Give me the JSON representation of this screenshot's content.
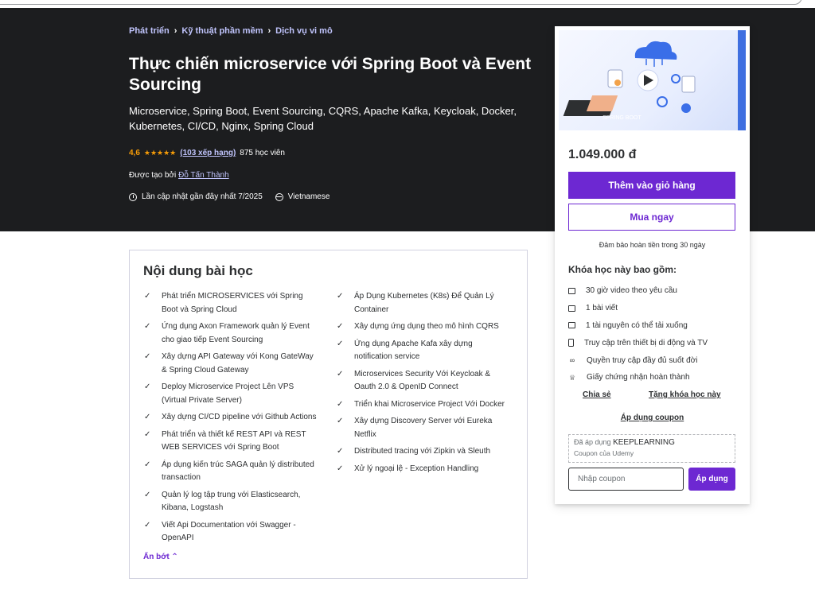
{
  "breadcrumb": [
    "Phát triển",
    "Kỹ thuật phần mềm",
    "Dịch vụ vi mô"
  ],
  "breadcrumb_sep": "›",
  "course": {
    "title": "Thực chiến microservice với Spring Boot và Event Sourcing",
    "subtitle": "Microservice, Spring Boot, Event Sourcing, CQRS, Apache Kafka, Keycloak, Docker, Kubernetes, CI/CD, Nginx, Spring Cloud",
    "rating": "4,6",
    "rating_value": 4.6,
    "stars": "★★★★★",
    "ratings_link": "(103 xếp hạng)",
    "students": "875 học viên",
    "author_prefix": "Được tạo bởi",
    "author": "Đỗ Tấn Thành",
    "updated": "Lần cập nhật gần đây nhất 7/2025",
    "language": "Vietnamese"
  },
  "sidebar": {
    "price": "1.049.000 đ",
    "add_to_cart": "Thêm vào giỏ hàng",
    "buy_now": "Mua ngay",
    "guarantee": "Đảm bảo hoàn tiền trong 30 ngày",
    "includes_title": "Khóa học này bao gồm:",
    "includes": [
      {
        "icon": "video-icon",
        "label": "30 giờ video theo yêu cầu"
      },
      {
        "icon": "article-icon",
        "label": "1 bài viết"
      },
      {
        "icon": "download-icon",
        "label": "1 tài nguyên có thể tải xuống"
      },
      {
        "icon": "mobile-icon",
        "label": "Truy cập trên thiết bị di động và TV"
      },
      {
        "icon": "infinity-icon",
        "label": "Quyền truy cập đầy đủ suốt đời"
      },
      {
        "icon": "trophy-icon",
        "label": "Giấy chứng nhận hoàn thành"
      }
    ],
    "share": "Chia sẻ",
    "gift": "Tặng khóa học này",
    "apply_coupon": "Áp dụng coupon",
    "applied_prefix": "Đã áp dụng",
    "applied_code": "KEEPLEARNING",
    "coupon_owner": "Coupon của Udemy",
    "coupon_placeholder": "Nhập coupon",
    "coupon_apply_button": "Áp dụng"
  },
  "learn": {
    "title": "Nội dung bài học",
    "check": "✓",
    "left": [
      "Phát triển MICROSERVICES với Spring Boot và Spring Cloud",
      "Ứng dụng Axon Framework quản lý Event cho giao tiếp Event Sourcing",
      "Xây dựng API Gateway với Kong GateWay & Spring Cloud Gateway",
      "Deploy Microservice Project Lên VPS (Virtual Private Server)",
      "Xây dựng CI/CD pipeline với Github Actions",
      "Phát triển và thiết kế REST API và REST WEB SERVICES với Spring Boot",
      "Áp dụng kiến trúc SAGA quản lý distributed transaction",
      "Quản lý log tập trung với Elasticsearch, Kibana, Logstash",
      "Viết Api Documentation với Swagger - OpenAPI"
    ],
    "right": [
      "Áp Dụng Kubernetes (K8s) Để Quản Lý Container",
      "Xây dựng ứng dụng theo mô hình CQRS",
      "Ứng dụng Apache Kafa xây dựng notification service",
      "Microservices Security Với Keycloak & Oauth 2.0 & OpenID Connect",
      "Triển khai Microservice Project Với Docker",
      "Xây dựng Discovery Server với Eureka Netflix",
      "Distributed tracing với Zipkin và Sleuth",
      "Xử lý ngoại lệ - Exception Handling"
    ],
    "show_less": "Ẩn bớt ⌃"
  },
  "colors": {
    "hero_bg": "#1c1d1f",
    "accent": "#6d28d2",
    "link_light": "#c0c4fc",
    "star": "#f69c08"
  }
}
